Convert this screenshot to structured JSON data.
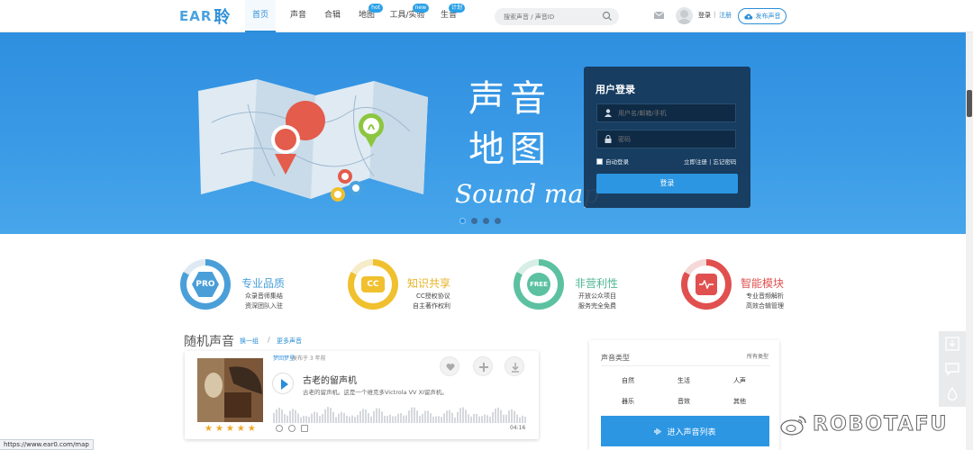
{
  "header": {
    "logo_text": "EAR",
    "logo_cn": "聆",
    "nav": [
      {
        "label": "首页",
        "badge": ""
      },
      {
        "label": "声音",
        "badge": ""
      },
      {
        "label": "合辑",
        "badge": ""
      },
      {
        "label": "地图",
        "badge": "hot"
      },
      {
        "label": "工具/实验",
        "badge": "new"
      },
      {
        "label": "生音",
        "badge": "计划"
      }
    ],
    "search_placeholder": "搜索声音 / 声音ID",
    "login": "登录",
    "separator": "|",
    "register": "注册",
    "upload": "发布声音"
  },
  "banner": {
    "title_line1": "声音",
    "title_line2": "地图",
    "subtitle": "Sound map",
    "login_panel": {
      "title": "用户登录",
      "username_placeholder": "用户名/邮箱/手机",
      "password_placeholder": "密码",
      "remember": "自动登录",
      "links": "立即注册 | 忘记密码",
      "submit": "登录"
    }
  },
  "features": [
    {
      "icon_text": "PRO",
      "title": "专业品质",
      "line1": "众录音师集结",
      "line2": "资深团队入驻",
      "color": "#4a9fd8"
    },
    {
      "icon_text": "CC",
      "title": "知识共享",
      "line1": "CC授权协议",
      "line2": "自主著作权利",
      "color": "#f0c02e"
    },
    {
      "icon_text": "FREE",
      "title": "非营利性",
      "line1": "开放公众项目",
      "line2": "服务完全免费",
      "color": "#5cc1a1"
    },
    {
      "icon_text": "",
      "title": "智能模块",
      "line1": "专业音频解析",
      "line2": "高效合辑管理",
      "color": "#e0504f"
    }
  ],
  "random": {
    "title": "随机声音",
    "link_refresh": "换一组",
    "slash": "/",
    "link_more": "更多声音",
    "card": {
      "author": "梦回梦里",
      "date": "发布于 3 年前",
      "title": "古老的留声机",
      "desc": "古老的留声机。这是一个维克多Victrola VV XI留声机。",
      "duration": "04:16",
      "stars": "★★★★★"
    }
  },
  "sound_types": {
    "title": "声音类型",
    "all": "所有类型",
    "items": [
      "自然",
      "生活",
      "人声",
      "器乐",
      "音效",
      "其他"
    ],
    "enter": "进入声音列表"
  },
  "status_url": "https://www.ear0.com/map",
  "watermark": "ROBOTAFU",
  "colors": {
    "accent": "#2b8ed6",
    "banner": "#3a9ae6",
    "panel": "#153556"
  }
}
